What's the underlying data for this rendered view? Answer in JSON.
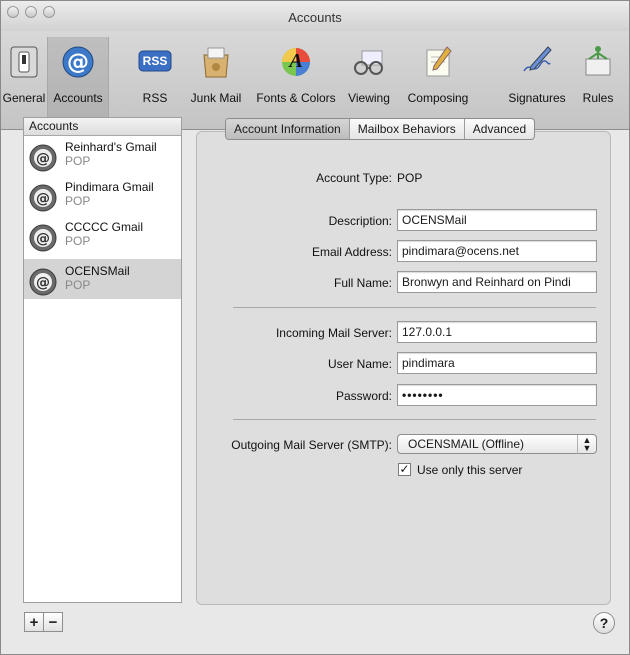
{
  "window": {
    "title": "Accounts"
  },
  "toolbar": {
    "items": [
      {
        "label": "General",
        "icon": "switch-icon"
      },
      {
        "label": "Accounts",
        "icon": "at-sign-icon"
      },
      {
        "label": "RSS",
        "icon": "rss-icon"
      },
      {
        "label": "Junk Mail",
        "icon": "junk-mail-icon"
      },
      {
        "label": "Fonts & Colors",
        "icon": "color-font-icon"
      },
      {
        "label": "Viewing",
        "icon": "glasses-icon"
      },
      {
        "label": "Composing",
        "icon": "pencil-pad-icon"
      },
      {
        "label": "Signatures",
        "icon": "signature-pen-icon"
      },
      {
        "label": "Rules",
        "icon": "rules-icon"
      }
    ],
    "rss_badge": "RSS",
    "fonts_badge": "A"
  },
  "sidebar": {
    "header": "Accounts",
    "accounts": [
      {
        "name": "Reinhard's Gmail",
        "type": "POP"
      },
      {
        "name": "Pindimara Gmail",
        "type": "POP"
      },
      {
        "name": "CCCCC Gmail",
        "type": "POP"
      },
      {
        "name": "OCENSMail",
        "type": "POP"
      }
    ],
    "add_label": "+",
    "remove_label": "−"
  },
  "tabs": [
    {
      "label": "Account Information"
    },
    {
      "label": "Mailbox Behaviors"
    },
    {
      "label": "Advanced"
    }
  ],
  "form": {
    "account_type_label": "Account Type:",
    "account_type_value": "POP",
    "description_label": "Description:",
    "description_value": "OCENSMail",
    "email_label": "Email Address:",
    "email_value": "pindimara@ocens.net",
    "fullname_label": "Full Name:",
    "fullname_value": "Bronwyn and Reinhard on Pindi",
    "incoming_label": "Incoming Mail Server:",
    "incoming_value": "127.0.0.1",
    "username_label": "User Name:",
    "username_value": "pindimara",
    "password_label": "Password:",
    "password_value": "••••••••",
    "smtp_label": "Outgoing Mail Server (SMTP):",
    "smtp_value": "OCENSMAIL (Offline)",
    "use_only_label": "Use only this server",
    "use_only_checked": "✓"
  },
  "help": {
    "label": "?"
  },
  "colors": {
    "selected_row": "#d4d4d4",
    "rss_blue": "#3b6fc4"
  }
}
